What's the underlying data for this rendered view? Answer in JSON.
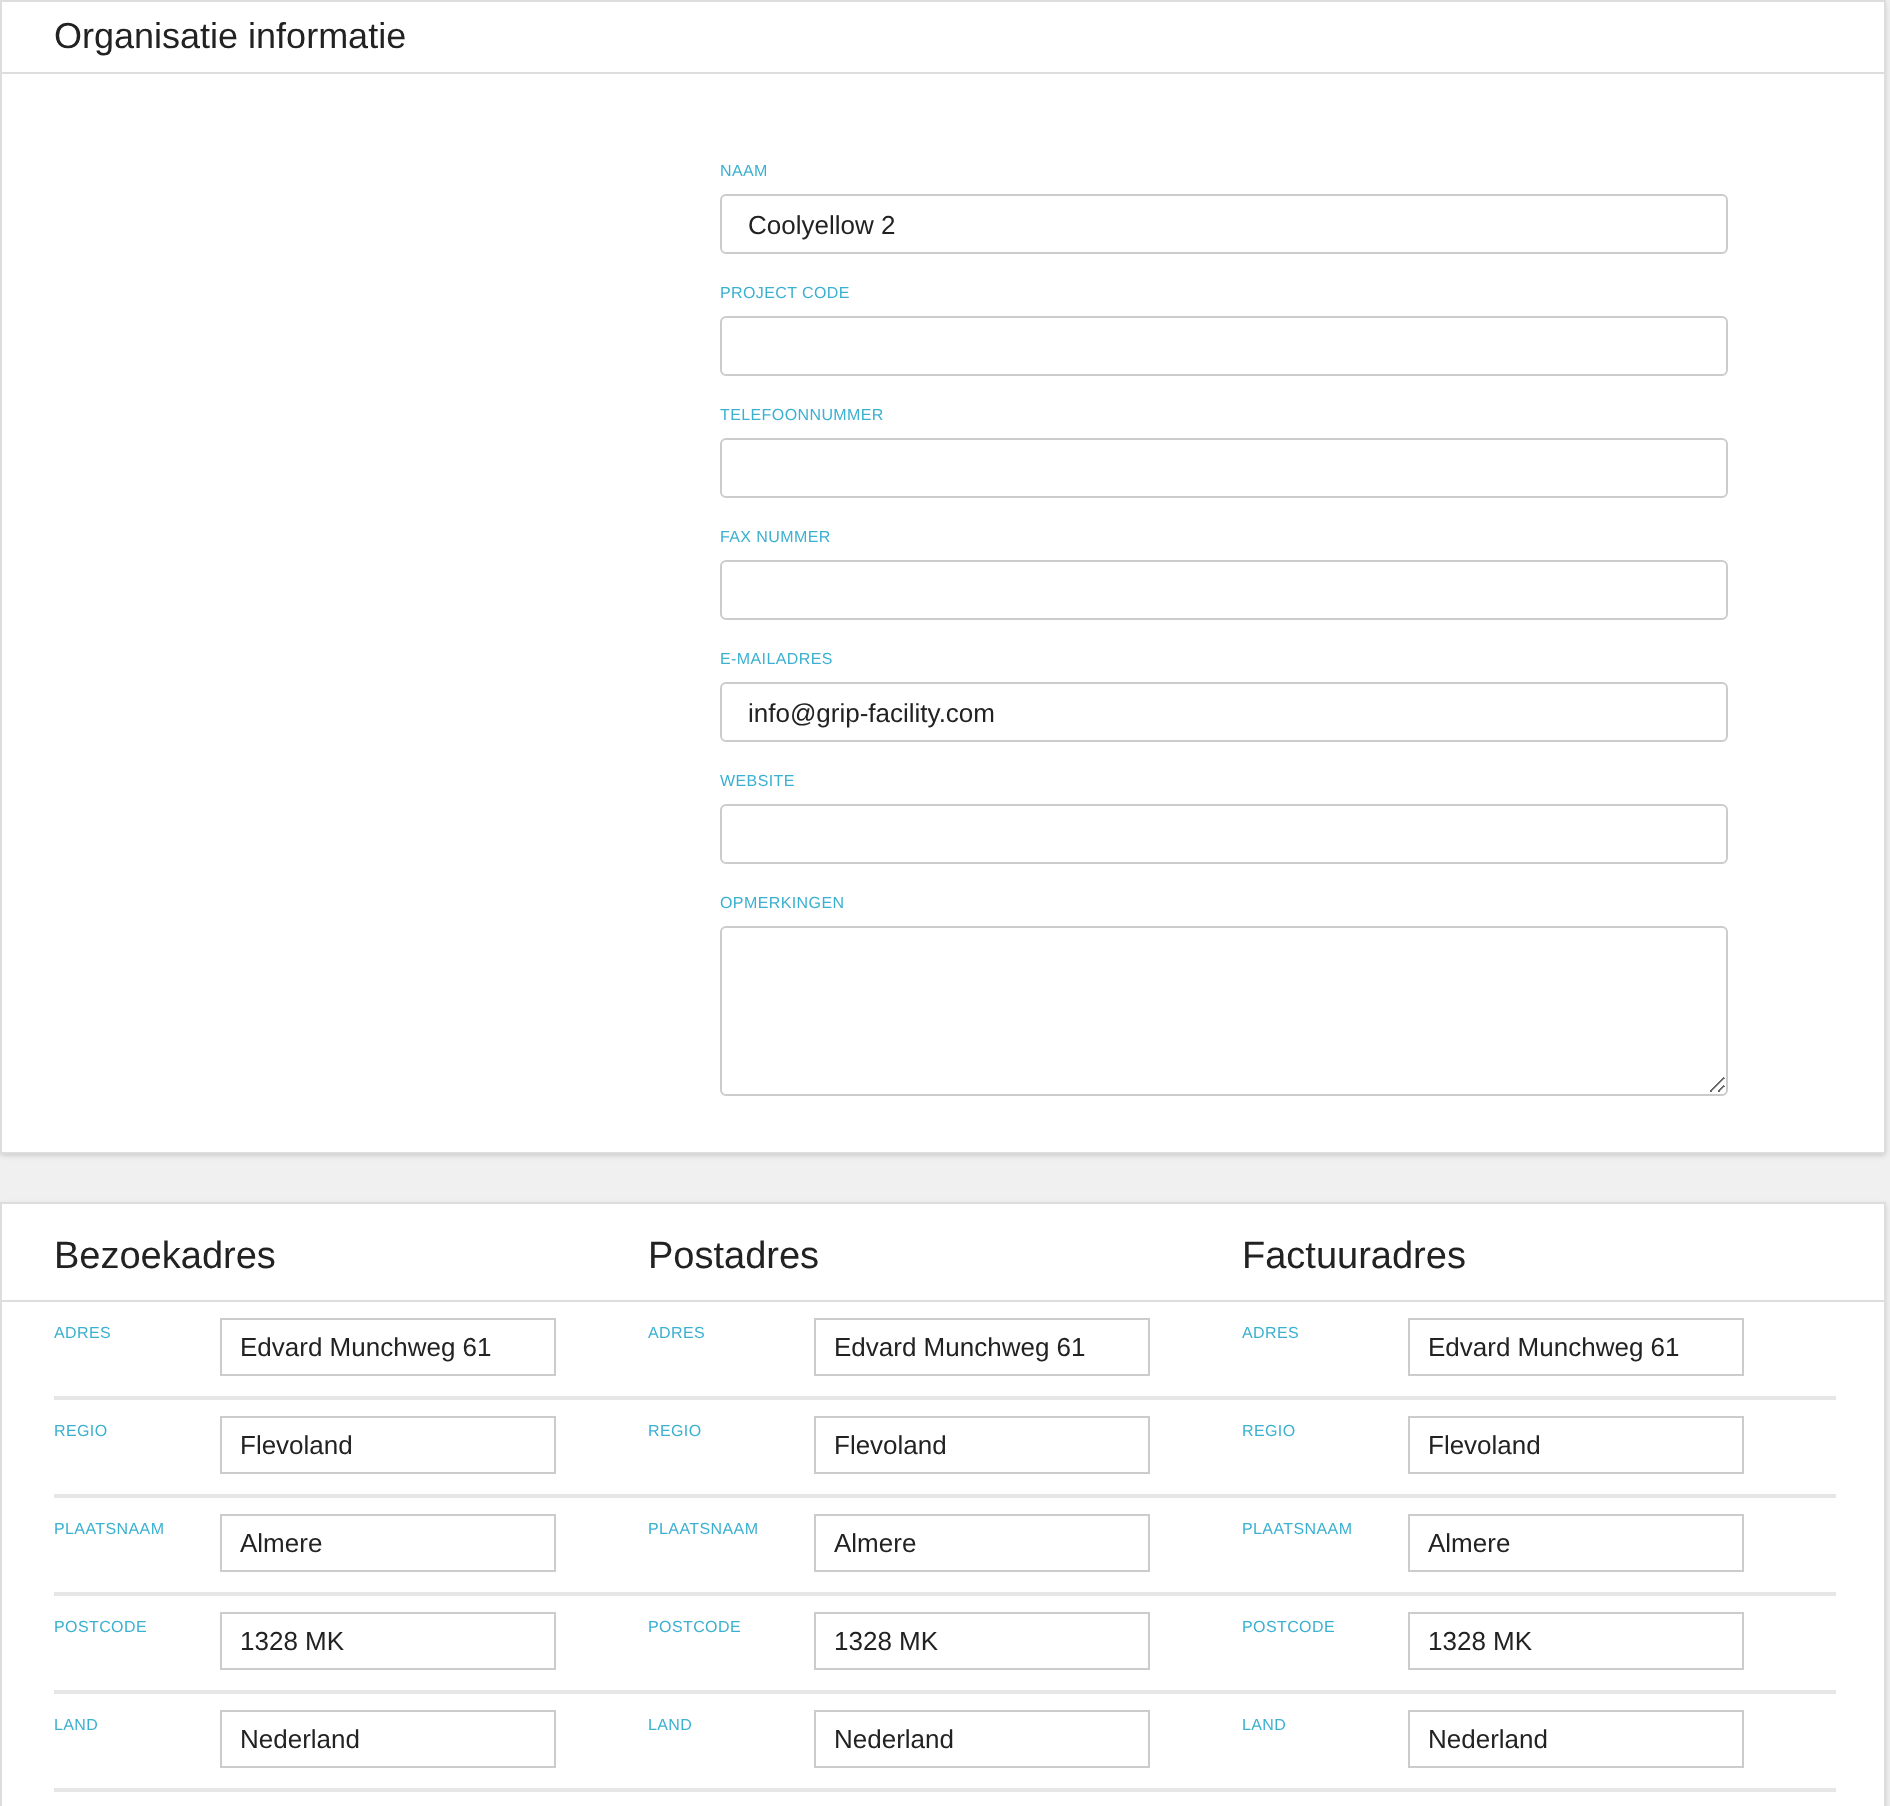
{
  "organisation": {
    "title": "Organisatie informatie",
    "fields": [
      {
        "label": "NAAM",
        "kind": "input",
        "value": "Coolyellow 2"
      },
      {
        "label": "PROJECT CODE",
        "kind": "input"
      },
      {
        "label": "TELEFOONNUMMER",
        "kind": "input"
      },
      {
        "label": "FAX NUMMER",
        "kind": "input"
      },
      {
        "label": "E-MAILADRES",
        "kind": "input",
        "value": "info@grip-facility.com"
      },
      {
        "label": "WEBSITE",
        "kind": "input"
      },
      {
        "label": "OPMERKINGEN",
        "kind": "textarea"
      }
    ]
  },
  "addresses": [
    {
      "title": "Bezoekadres",
      "fields": [
        {
          "label": "ADRES",
          "value": "Edvard Munchweg 61"
        },
        {
          "label": "REGIO",
          "value": "Flevoland"
        },
        {
          "label": "PLAATSNAAM",
          "value": "Almere"
        },
        {
          "label": "POSTCODE",
          "value": "1328 MK"
        },
        {
          "label": "LAND",
          "value": "Nederland"
        }
      ]
    },
    {
      "title": "Postadres",
      "fields": [
        {
          "label": "ADRES",
          "value": "Edvard Munchweg 61"
        },
        {
          "label": "REGIO",
          "value": "Flevoland"
        },
        {
          "label": "PLAATSNAAM",
          "value": "Almere"
        },
        {
          "label": "POSTCODE",
          "value": "1328 MK"
        },
        {
          "label": "LAND",
          "value": "Nederland"
        }
      ]
    },
    {
      "title": "Factuuradres",
      "fields": [
        {
          "label": "ADRES",
          "value": "Edvard Munchweg 61"
        },
        {
          "label": "REGIO",
          "value": "Flevoland"
        },
        {
          "label": "PLAATSNAAM",
          "value": "Almere"
        },
        {
          "label": "POSTCODE",
          "value": "1328 MK"
        },
        {
          "label": "LAND",
          "value": "Nederland"
        }
      ]
    }
  ]
}
